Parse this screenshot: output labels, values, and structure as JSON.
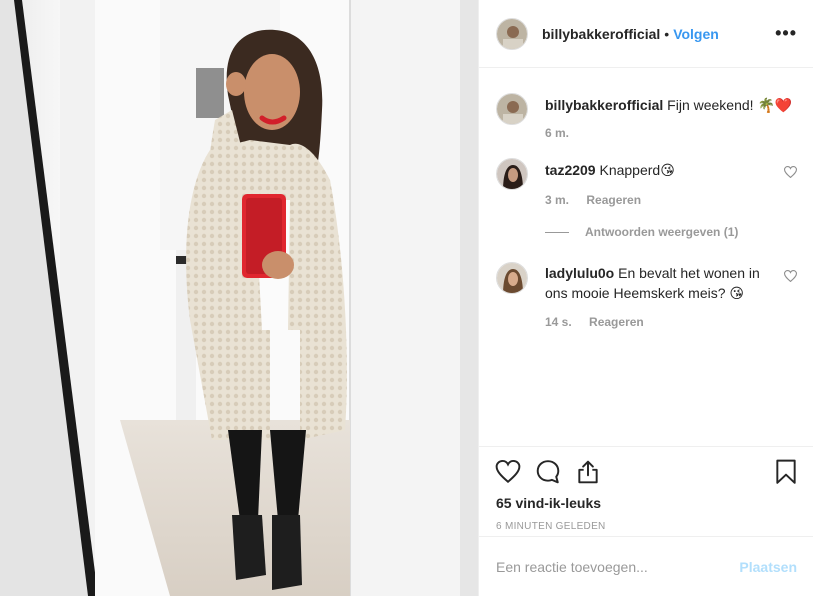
{
  "post": {
    "username": "billybakkerofficial",
    "separator": "•",
    "follow_label": "Volgen",
    "more_icon": "more-options-icon",
    "more_glyph": "•••"
  },
  "comments": [
    {
      "username": "billybakkerofficial",
      "text": "Fijn weekend! 🌴❤️",
      "time": "6 m.",
      "reply_label": ""
    },
    {
      "username": "taz2209",
      "text": "Knapperd😘",
      "time": "3 m.",
      "reply_label": "Reageren"
    },
    {
      "username": "ladylulu0o",
      "text": "En bevalt het wonen in ons mooie Heemskerk meis? 😘",
      "time": "14 s.",
      "reply_label": "Reageren"
    }
  ],
  "view_replies_label": "Antwoorden weergeven (1)",
  "likes_label": "65 vind-ik-leuks",
  "posted_ago": "6 MINUTEN GELEDEN",
  "add_comment": {
    "placeholder": "Een reactie toevoegen...",
    "value": "",
    "post_label": "Plaatsen"
  },
  "colors": {
    "accent": "#3897f0",
    "post_disabled": "#b2dffc",
    "muted": "#999999",
    "text": "#262626"
  }
}
